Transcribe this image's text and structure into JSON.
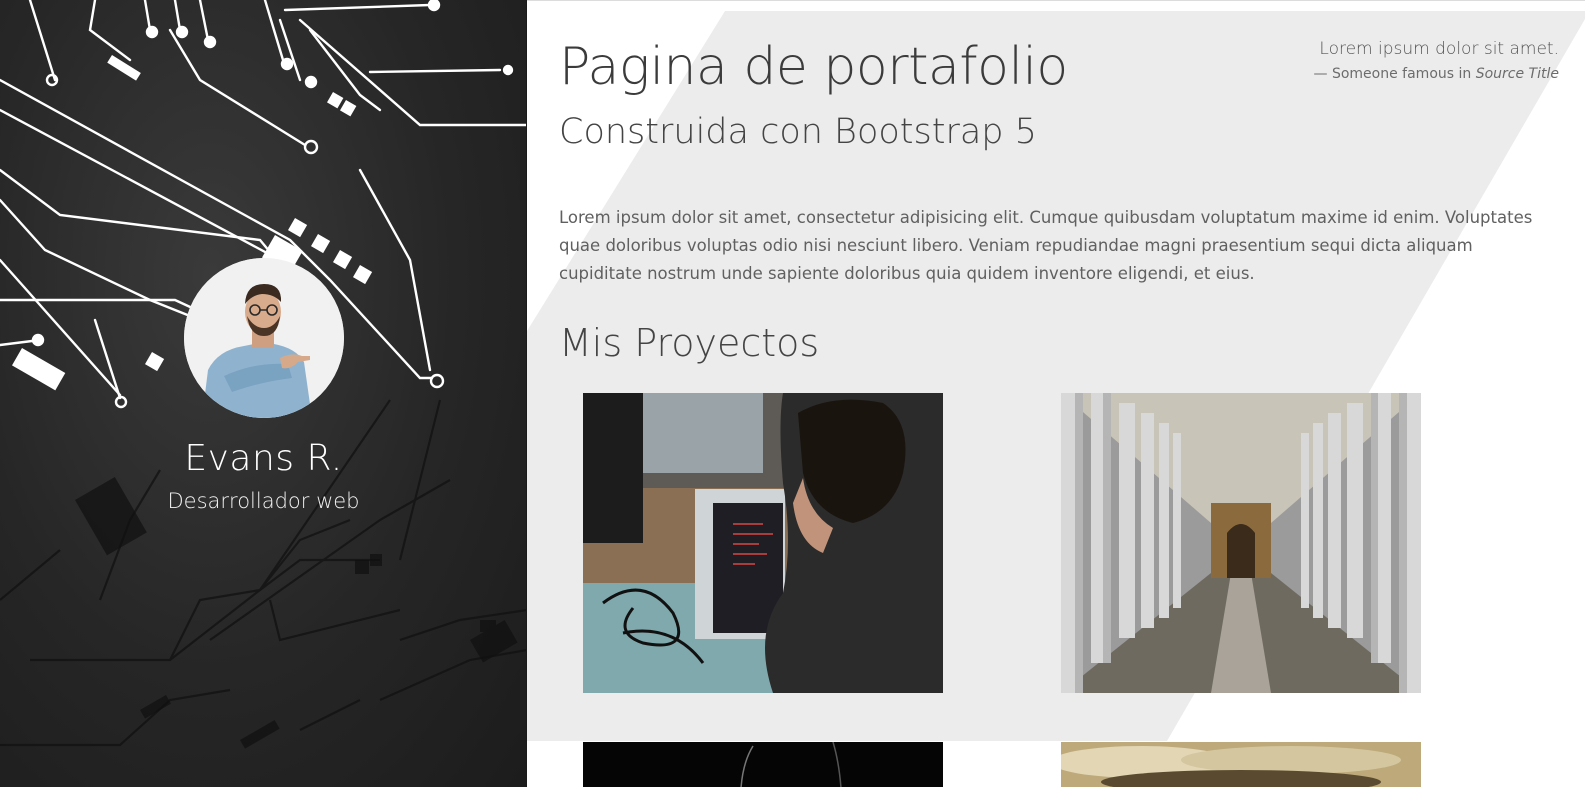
{
  "sidebar": {
    "name": "Evans R.",
    "role": "Desarrollador web",
    "avatar_icon": "person-portrait-icon"
  },
  "header": {
    "title": "Pagina de portafolio",
    "subtitle": "Construida con Bootstrap 5"
  },
  "quote": {
    "text": "Lorem ipsum dolor sit amet.",
    "dash": "—",
    "author": "Someone famous in",
    "source": "Source Title"
  },
  "intro": {
    "text": "Lorem ipsum dolor sit amet, consectetur adipisicing elit. Cumque quibusdam voluptatum maxime id enim. Voluptates quae doloribus voluptas odio nisi nesciunt libero. Veniam repudiandae magni praesentium sequi dicta aliquam cupiditate nostrum unde sapiente doloribus quia quidem inventore eligendi, et eius."
  },
  "projects": {
    "heading": "Mis Proyectos",
    "items": [
      {
        "image": "person-coding-laptop-photo"
      },
      {
        "image": "colonnade-corridor-photo"
      },
      {
        "image": "dark-project-photo"
      },
      {
        "image": "cloudy-sky-photo"
      }
    ]
  },
  "colors": {
    "sidebar_bg": "#262626",
    "main_bg": "#ffffff",
    "diagonal_band": "#ececec",
    "text_dark": "#3b3b3b",
    "text_body": "#606060"
  }
}
